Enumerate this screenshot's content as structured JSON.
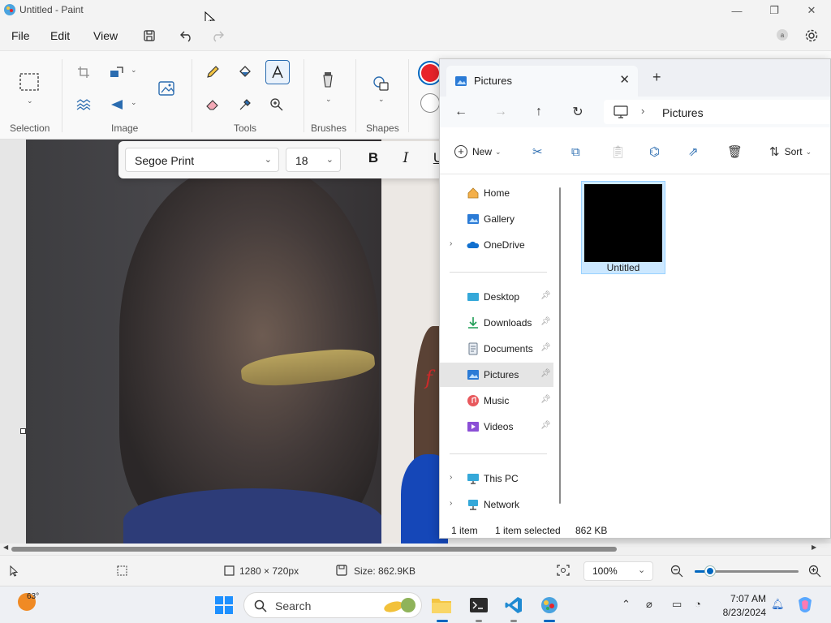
{
  "paint": {
    "title": "Untitled - Paint",
    "menu": {
      "file": "File",
      "edit": "Edit",
      "view": "View"
    },
    "ribbon": {
      "selection": "Selection",
      "image": "Image",
      "tools": "Tools",
      "brushes": "Brushes",
      "shapes": "Shapes"
    },
    "text_toolbar": {
      "font": "Segoe Print",
      "size": "18",
      "bold": "B",
      "italic": "I",
      "underline": "U"
    },
    "status": {
      "dimensions": "1280 × 720px",
      "size": "Size: 862.9KB",
      "zoom": "100%",
      "zoom_level": 0.15
    },
    "accent_color": "#e8242a"
  },
  "explorer": {
    "tab_title": "Pictures",
    "breadcrumb": "Pictures",
    "commands": {
      "new": "New",
      "sort": "Sort"
    },
    "nav": [
      {
        "label": "Home",
        "icon": "home-icon"
      },
      {
        "label": "Gallery",
        "icon": "gallery-icon"
      },
      {
        "label": "OneDrive",
        "icon": "onedrive-icon"
      },
      {
        "label": "Desktop",
        "icon": "desktop-icon"
      },
      {
        "label": "Downloads",
        "icon": "downloads-icon"
      },
      {
        "label": "Documents",
        "icon": "documents-icon"
      },
      {
        "label": "Pictures",
        "icon": "pictures-icon"
      },
      {
        "label": "Music",
        "icon": "music-icon"
      },
      {
        "label": "Videos",
        "icon": "videos-icon"
      },
      {
        "label": "This PC",
        "icon": "this-pc-icon"
      },
      {
        "label": "Network",
        "icon": "network-icon"
      }
    ],
    "file": {
      "name": "Untitled"
    },
    "status": {
      "count": "1 item",
      "selected": "1 item selected",
      "size": "862 KB"
    }
  },
  "taskbar": {
    "temperature": "63°",
    "search_placeholder": "Search",
    "time": "7:07 AM",
    "date": "8/23/2024"
  }
}
